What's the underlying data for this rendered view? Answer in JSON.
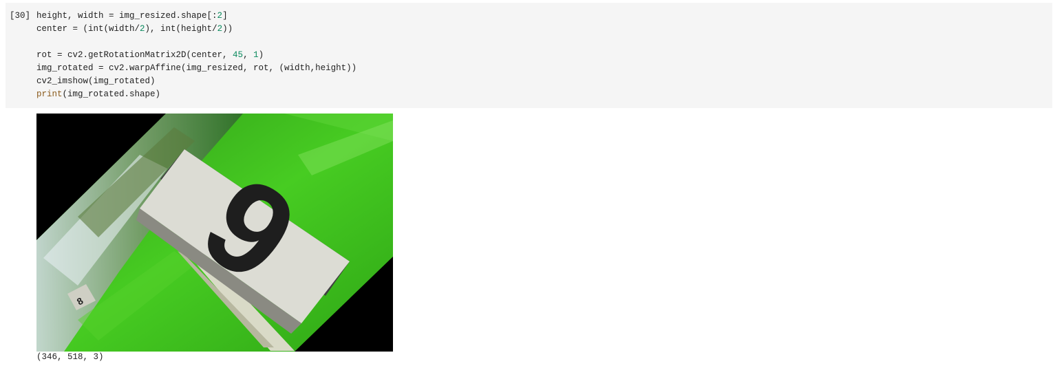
{
  "cell": {
    "execution_count": "[30]",
    "code": [
      [
        {
          "t": "height, width = img_resized.shape[:"
        },
        {
          "t": "2",
          "c": "num"
        },
        {
          "t": "]"
        }
      ],
      [
        {
          "t": "center = (int(width/"
        },
        {
          "t": "2",
          "c": "num"
        },
        {
          "t": "), int(height/"
        },
        {
          "t": "2",
          "c": "num"
        },
        {
          "t": "))"
        }
      ],
      [
        {
          "t": ""
        }
      ],
      [
        {
          "t": "rot = cv2.getRotationMatrix2D(center, "
        },
        {
          "t": "45",
          "c": "num"
        },
        {
          "t": ", "
        },
        {
          "t": "1",
          "c": "num"
        },
        {
          "t": ")"
        }
      ],
      [
        {
          "t": "img_rotated = cv2.warpAffine(img_resized, rot, (width,height))"
        }
      ],
      [
        {
          "t": "cv2_imshow(img_rotated)"
        }
      ],
      [
        {
          "t": "print",
          "c": "kw"
        },
        {
          "t": "(img_rotated.shape)"
        }
      ]
    ]
  },
  "output": {
    "image_icon": "rotated-photo-golf-tee-marker-number-9",
    "stdout": "(346, 518, 3)"
  },
  "colors": {
    "code_background": "#f5f5f5",
    "number_literal": "#0b8a5e",
    "builtin_function": "#8a5a1b",
    "grass": "#3fc21e",
    "sign_face": "#dcdcd4"
  }
}
